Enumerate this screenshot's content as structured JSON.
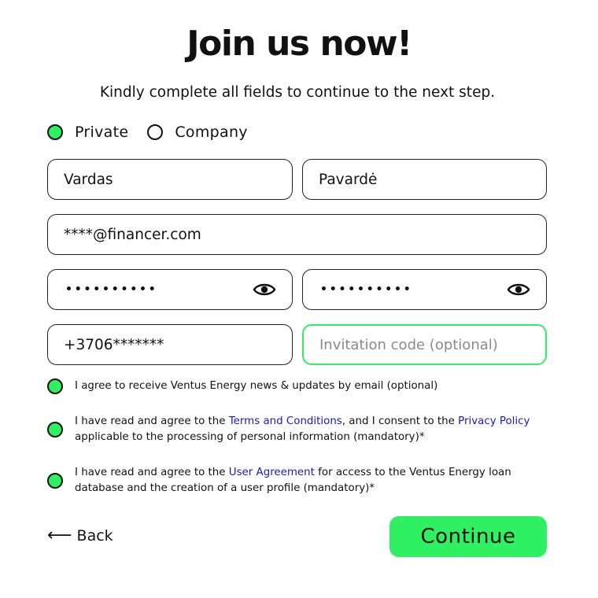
{
  "header": {
    "title": "Join us now!",
    "subtitle": "Kindly complete all fields to continue to the next step."
  },
  "account_type": {
    "options": [
      {
        "label": "Private",
        "selected": true
      },
      {
        "label": "Company",
        "selected": false
      }
    ]
  },
  "form": {
    "first_name": {
      "value": "Vardas"
    },
    "last_name": {
      "value": "Pavardė"
    },
    "email": {
      "value": "****@financer.com"
    },
    "password": {
      "value": "••••••••••",
      "icon": "eye-icon"
    },
    "password_confirm": {
      "value": "••••••••••",
      "icon": "eye-icon"
    },
    "phone": {
      "value": "+3706*******"
    },
    "invitation_code": {
      "value": "",
      "placeholder": "Invitation code (optional)"
    }
  },
  "consents": {
    "news": {
      "checked": true,
      "text": "I agree to receive Ventus Energy news & updates by email (optional)"
    },
    "terms": {
      "checked": true,
      "text_before": "I have read and agree to the ",
      "link1": "Terms and Conditions",
      "text_middle": ", and I consent to the ",
      "link2": "Privacy Policy",
      "text_after": " applicable to the processing of personal information (mandatory)*"
    },
    "user_agreement": {
      "checked": true,
      "text_before": "I have read and agree to the ",
      "link": "User Agreement",
      "text_after": " for access to the Ventus Energy loan database and the creation of a user profile (mandatory)*"
    }
  },
  "actions": {
    "back_arrow": "⟵",
    "back_label": "Back",
    "continue_label": "Continue"
  },
  "colors": {
    "accent": "#2ef060",
    "link": "#1a1ab8",
    "text": "#111111",
    "border": "#222222",
    "placeholder": "#8a8a8a"
  }
}
